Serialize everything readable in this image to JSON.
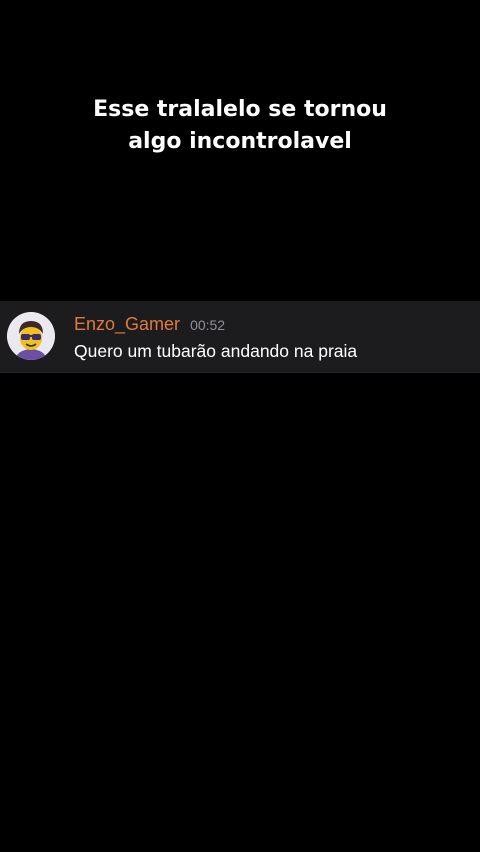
{
  "caption": {
    "line1": "Esse tralalelo se tornou",
    "line2": "algo incontrolavel"
  },
  "message": {
    "avatar_icon": "user-avatar-icon",
    "username": "Enzo_Gamer",
    "username_color": "#e07a3c",
    "timestamp": "00:52",
    "text": "Quero um tubarão andando na praia"
  }
}
